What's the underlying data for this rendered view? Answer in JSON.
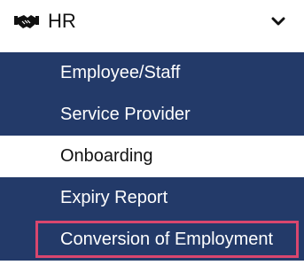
{
  "header": {
    "icon": "handshake-icon",
    "title": "HR",
    "toggle_icon": "chevron-down-icon"
  },
  "menu": {
    "items": [
      {
        "label": "Employee/Staff",
        "state": "normal"
      },
      {
        "label": "Service Provider",
        "state": "normal"
      },
      {
        "label": "Onboarding",
        "state": "active"
      },
      {
        "label": "Expiry Report",
        "state": "normal"
      },
      {
        "label": "Conversion of Employment",
        "state": "highlighted"
      }
    ]
  },
  "colors": {
    "menu_bg": "#233a69",
    "active_bg": "#ffffff",
    "highlight_border": "#d9466e"
  }
}
